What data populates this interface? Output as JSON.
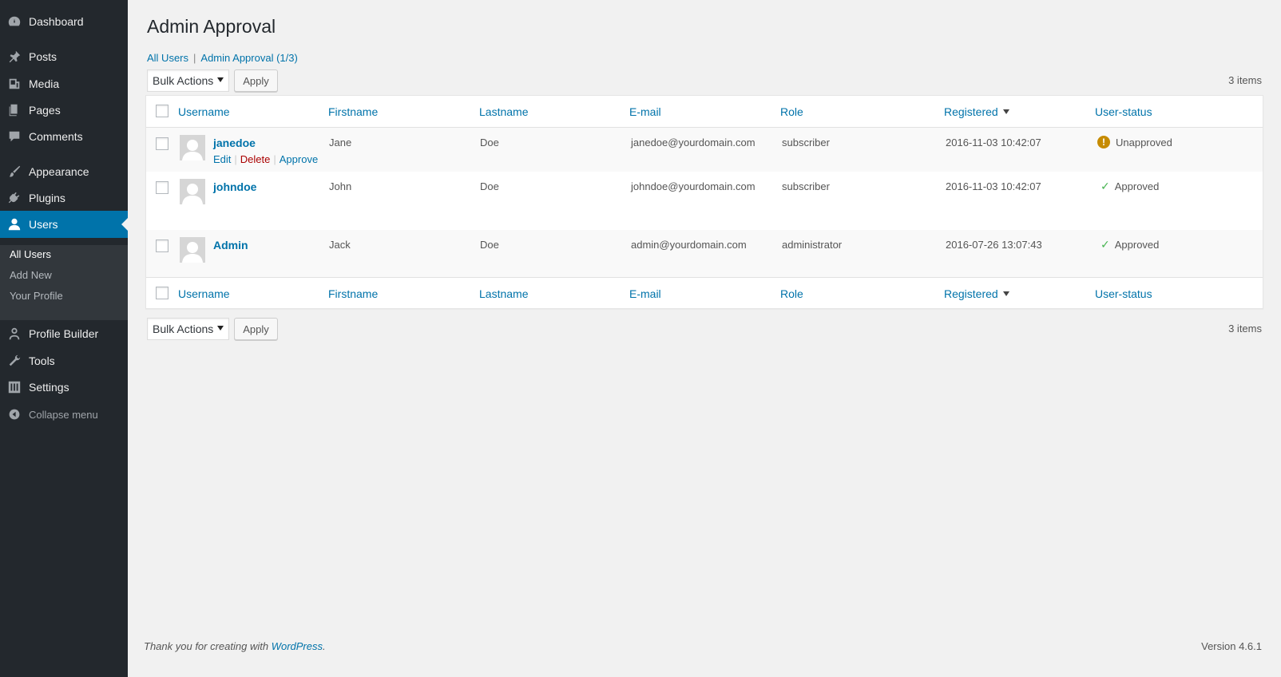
{
  "sidebar": {
    "items": [
      {
        "label": "Dashboard",
        "icon": "dashboard-icon"
      },
      {
        "label": "Posts",
        "icon": "pin-icon"
      },
      {
        "label": "Media",
        "icon": "media-icon"
      },
      {
        "label": "Pages",
        "icon": "pages-icon"
      },
      {
        "label": "Comments",
        "icon": "comment-icon"
      },
      {
        "label": "Appearance",
        "icon": "brush-icon"
      },
      {
        "label": "Plugins",
        "icon": "plug-icon"
      },
      {
        "label": "Users",
        "icon": "user-icon"
      },
      {
        "label": "Profile Builder",
        "icon": "person-icon"
      },
      {
        "label": "Tools",
        "icon": "wrench-icon"
      },
      {
        "label": "Settings",
        "icon": "sliders-icon"
      }
    ],
    "submenu": [
      "All Users",
      "Add New",
      "Your Profile"
    ],
    "collapse_label": "Collapse menu"
  },
  "page": {
    "title": "Admin Approval",
    "filters": {
      "all_users": "All Users",
      "separator": "|",
      "admin_approval": "Admin Approval (1/3)"
    }
  },
  "tablenav": {
    "bulk_actions": "Bulk Actions",
    "apply": "Apply",
    "items_count": "3 items"
  },
  "table": {
    "columns": [
      "Username",
      "Firstname",
      "Lastname",
      "E-mail",
      "Role",
      "Registered",
      "User-status"
    ],
    "rows": [
      {
        "username": "janedoe",
        "firstname": "Jane",
        "lastname": "Doe",
        "email": "janedoe@yourdomain.com",
        "role": "subscriber",
        "registered": "2016-11-03 10:42:07",
        "status": "Unapproved",
        "status_icon": "warning-icon",
        "actions": [
          "Edit",
          "Delete",
          "Approve"
        ]
      },
      {
        "username": "johndoe",
        "firstname": "John",
        "lastname": "Doe",
        "email": "johndoe@yourdomain.com",
        "role": "subscriber",
        "registered": "2016-11-03 10:42:07",
        "status": "Approved",
        "status_icon": "check-icon"
      },
      {
        "username": "Admin",
        "firstname": "Jack",
        "lastname": "Doe",
        "email": "admin@yourdomain.com",
        "role": "administrator",
        "registered": "2016-07-26 13:07:43",
        "status": "Approved",
        "status_icon": "check-icon"
      }
    ]
  },
  "footer": {
    "thanks_prefix": "Thank you for creating with ",
    "wordpress_link": "WordPress",
    "thanks_suffix": ".",
    "version": "Version 4.6.1"
  },
  "colors": {
    "sidebar_bg": "#23282d",
    "accent": "#0073aa",
    "delete": "#aa0000",
    "approved": "#46b450",
    "unapproved": "#c68b00"
  }
}
